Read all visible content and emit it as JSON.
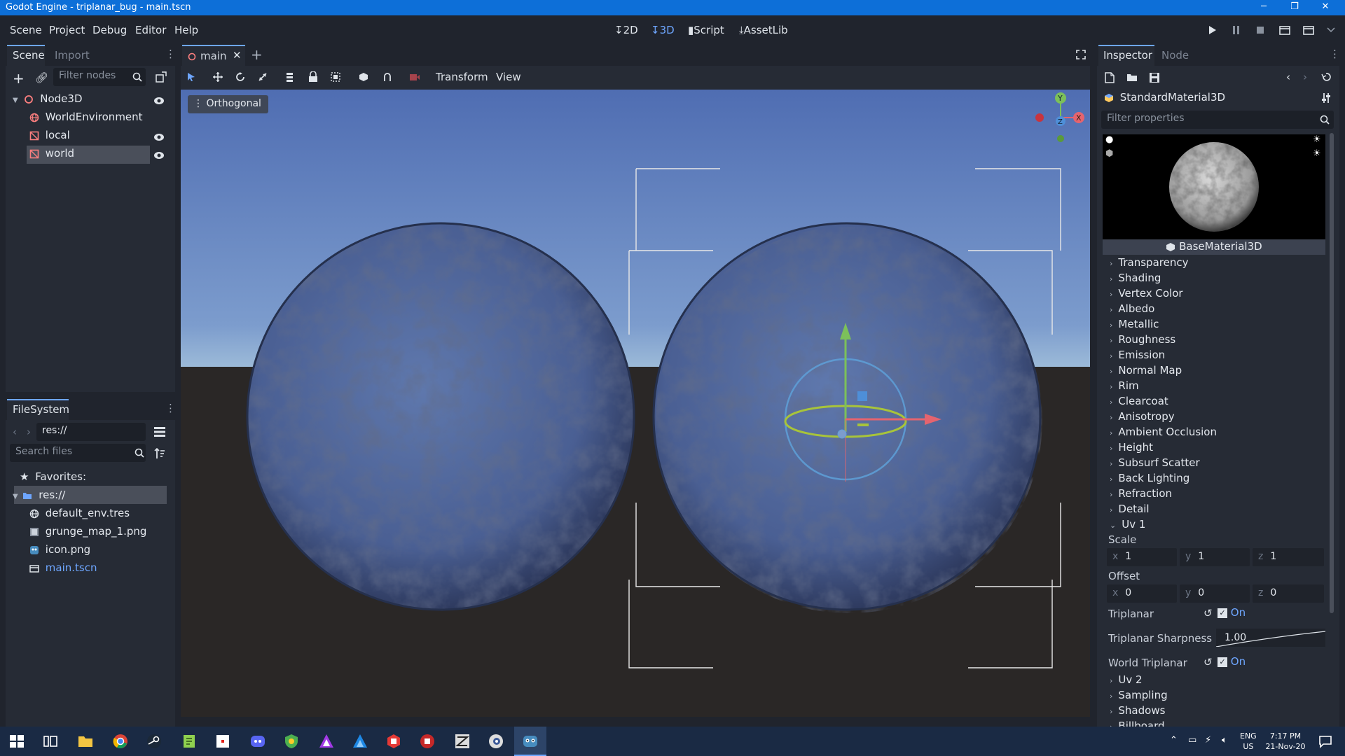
{
  "window": {
    "title": "Godot Engine - triplanar_bug - main.tscn"
  },
  "menus": [
    "Scene",
    "Project",
    "Debug",
    "Editor",
    "Help"
  ],
  "workspaces": [
    {
      "label": "2D",
      "active": false
    },
    {
      "label": "3D",
      "active": true
    },
    {
      "label": "Script",
      "active": false
    },
    {
      "label": "AssetLib",
      "active": false
    }
  ],
  "scene_dock": {
    "tabs": [
      "Scene",
      "Import"
    ],
    "filter_placeholder": "Filter nodes",
    "nodes": [
      {
        "label": "Node3D",
        "indent": 0,
        "eye": true
      },
      {
        "label": "WorldEnvironment",
        "indent": 1,
        "eye": false
      },
      {
        "label": "local",
        "indent": 1,
        "eye": true
      },
      {
        "label": "world",
        "indent": 1,
        "eye": true,
        "selected": true
      }
    ]
  },
  "filesystem": {
    "title": "FileSystem",
    "path": "res://",
    "search_placeholder": "Search files",
    "favorites_label": "Favorites:",
    "items": [
      {
        "label": "res://",
        "kind": "folder"
      },
      {
        "label": "default_env.tres",
        "kind": "resource"
      },
      {
        "label": "grunge_map_1.png",
        "kind": "image"
      },
      {
        "label": "icon.png",
        "kind": "image"
      },
      {
        "label": "main.tscn",
        "kind": "scene"
      }
    ]
  },
  "editor": {
    "tab_label": "main",
    "toolbar_menus": [
      "Transform",
      "View"
    ],
    "view_mode": "Orthogonal"
  },
  "inspector": {
    "tabs": [
      "Inspector",
      "Node"
    ],
    "resource_name": "StandardMaterial3D",
    "filter_placeholder": "Filter properties",
    "section_title": "BaseMaterial3D",
    "groups": [
      "Transparency",
      "Shading",
      "Vertex Color",
      "Albedo",
      "Metallic",
      "Roughness",
      "Emission",
      "Normal Map",
      "Rim",
      "Clearcoat",
      "Anisotropy",
      "Ambient Occlusion",
      "Height",
      "Subsurf Scatter",
      "Back Lighting",
      "Refraction",
      "Detail"
    ],
    "uv1": {
      "label": "Uv 1",
      "scale_label": "Scale",
      "scale": {
        "x": "1",
        "y": "1",
        "z": "1"
      },
      "offset_label": "Offset",
      "offset": {
        "x": "0",
        "y": "0",
        "z": "0"
      },
      "triplanar_label": "Triplanar",
      "triplanar_value": "On",
      "sharpness_label": "Triplanar Sharpness",
      "sharpness_value": "1.00",
      "world_triplanar_label": "World Triplanar",
      "world_triplanar_value": "On"
    },
    "groups_after": [
      "Uv 2",
      "Sampling",
      "Shadows",
      "Billboard"
    ]
  },
  "taskbar": {
    "lang": "ENG",
    "region": "US",
    "time": "7:17 PM",
    "date": "21-Nov-20"
  },
  "colors": {
    "accent": "#6ea6ff",
    "titlebar": "#0d6fd8",
    "sky_top": "#4f6db2",
    "horizon": "#8fb0d4",
    "ground": "#2a2726"
  }
}
